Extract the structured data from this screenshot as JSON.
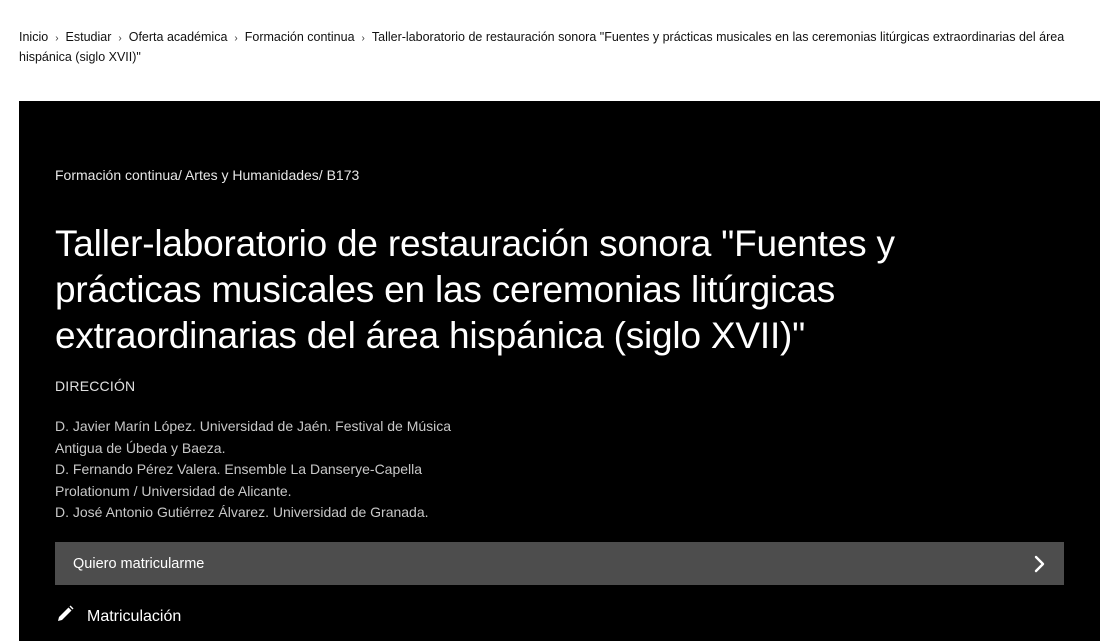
{
  "breadcrumb": {
    "items": [
      "Inicio",
      "Estudiar",
      "Oferta académica",
      "Formación continua",
      "Taller-laboratorio de restauración sonora \"Fuentes y prácticas musicales en las ceremonias litúrgicas extraordinarias del área hispánica (siglo XVII)\""
    ],
    "separator": "›"
  },
  "hero": {
    "category_path": "Formación continua/ Artes y Humanidades/ B173",
    "title": "Taller-laboratorio de restauración sonora \"Fuentes y prácticas musicales en las ceremonias litúrgicas extraordinarias del área hispánica (siglo XVII)\"",
    "direction_label": "DIRECCIÓN",
    "directors": [
      "D. Javier Marín López. Universidad de Jaén. Festival de Música Antigua de Úbeda y Baeza.",
      "D. Fernando Pérez Valera. Ensemble La Danserye-Capella Prolationum / Universidad de Alicante.",
      "D. José Antonio Gutiérrez Álvarez. Universidad de Granada."
    ],
    "enroll_button": "Quiero matricularme",
    "enroll_icon": "chevron-right-icon",
    "section_title": "Matriculación",
    "section_icon": "pencil-icon"
  },
  "colors": {
    "hero_bg": "#000000",
    "enroll_bar_bg": "#4d4d4d",
    "text_light": "#ffffff"
  }
}
